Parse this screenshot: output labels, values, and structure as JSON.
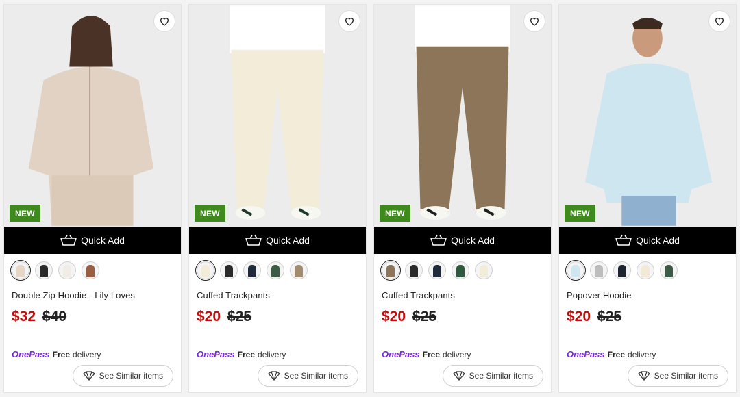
{
  "products": [
    {
      "badge": "NEW",
      "quick_add": "Quick Add",
      "title": "Double Zip Hoodie - Lily Loves",
      "price_now": "$32",
      "price_was": "$40",
      "onepass_logo": "OnePass",
      "onepass_free": "Free",
      "onepass_delivery": "delivery",
      "similar_label": "See Similar items",
      "photo_bg": "#ececec",
      "garment_color": "#e2d2c3",
      "swatches": [
        "#e6d6c6",
        "#2b2b2b",
        "#f1ede6",
        "#9a5f43"
      ]
    },
    {
      "badge": "NEW",
      "quick_add": "Quick Add",
      "title": "Cuffed Trackpants",
      "price_now": "$20",
      "price_was": "$25",
      "onepass_logo": "OnePass",
      "onepass_free": "Free",
      "onepass_delivery": "delivery",
      "similar_label": "See Similar items",
      "photo_bg": "#ececec",
      "garment_color": "#f3ecd9",
      "swatches": [
        "#f3ecd9",
        "#2a2a2a",
        "#1f2a3a",
        "#3d5c45",
        "#a28b6f"
      ]
    },
    {
      "badge": "NEW",
      "quick_add": "Quick Add",
      "title": "Cuffed Trackpants",
      "price_now": "$20",
      "price_was": "$25",
      "onepass_logo": "OnePass",
      "onepass_free": "Free",
      "onepass_delivery": "delivery",
      "similar_label": "See Similar items",
      "photo_bg": "#ececec",
      "garment_color": "#8c7559",
      "swatches": [
        "#8c7559",
        "#2a2a2a",
        "#1f2a3a",
        "#2f5a3d",
        "#f3ecd9"
      ]
    },
    {
      "badge": "NEW",
      "quick_add": "Quick Add",
      "title": "Popover Hoodie",
      "price_now": "$20",
      "price_was": "$25",
      "onepass_logo": "OnePass",
      "onepass_free": "Free",
      "onepass_delivery": "delivery",
      "similar_label": "See Similar items",
      "photo_bg": "#ececec",
      "garment_color": "#cde6f0",
      "swatches": [
        "#cde6f0",
        "#bdbdbd",
        "#1e2430",
        "#f2ead7",
        "#3d5a44"
      ]
    }
  ],
  "icons": {
    "wishlist": "heart-icon",
    "quick_add": "basket-icon",
    "similar": "similar-icon"
  }
}
